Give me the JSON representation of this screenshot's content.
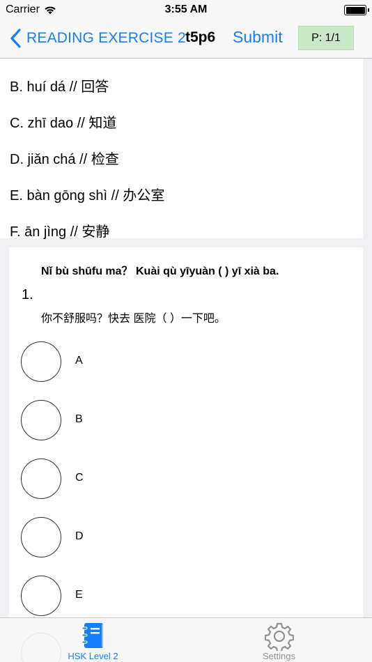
{
  "status_bar": {
    "carrier": "Carrier",
    "time": "3:55 AM"
  },
  "nav": {
    "back_label": "READING EXERCISE 2",
    "title": "t5p6",
    "submit_label": "Submit",
    "page_indicator": "P: 1/1"
  },
  "options": [
    "B. huí dá // 回答",
    "C. zhī dao // 知道",
    "D. jiǎn chá // 检查",
    "E. bàn gōng shì // 办公室",
    "F. ān jìng // 安静"
  ],
  "question": {
    "number": "1.",
    "pinyin": "Nǐ bù shūfu ma？ Kuài qù yīyuàn (      ) yī xià ba.",
    "hanzi": "你不舒服吗？快去  医院（    ）一下吧。",
    "choices": [
      "A",
      "B",
      "C",
      "D",
      "E"
    ]
  },
  "tab_bar": {
    "tabs": [
      {
        "label": "HSK Level 2",
        "icon": "notebook-icon",
        "selected": true
      },
      {
        "label": "Settings",
        "icon": "gear-icon",
        "selected": false
      }
    ]
  },
  "colors": {
    "accent": "#147efb",
    "badge_bg": "#cbe8c8",
    "background": "#efeff4"
  }
}
